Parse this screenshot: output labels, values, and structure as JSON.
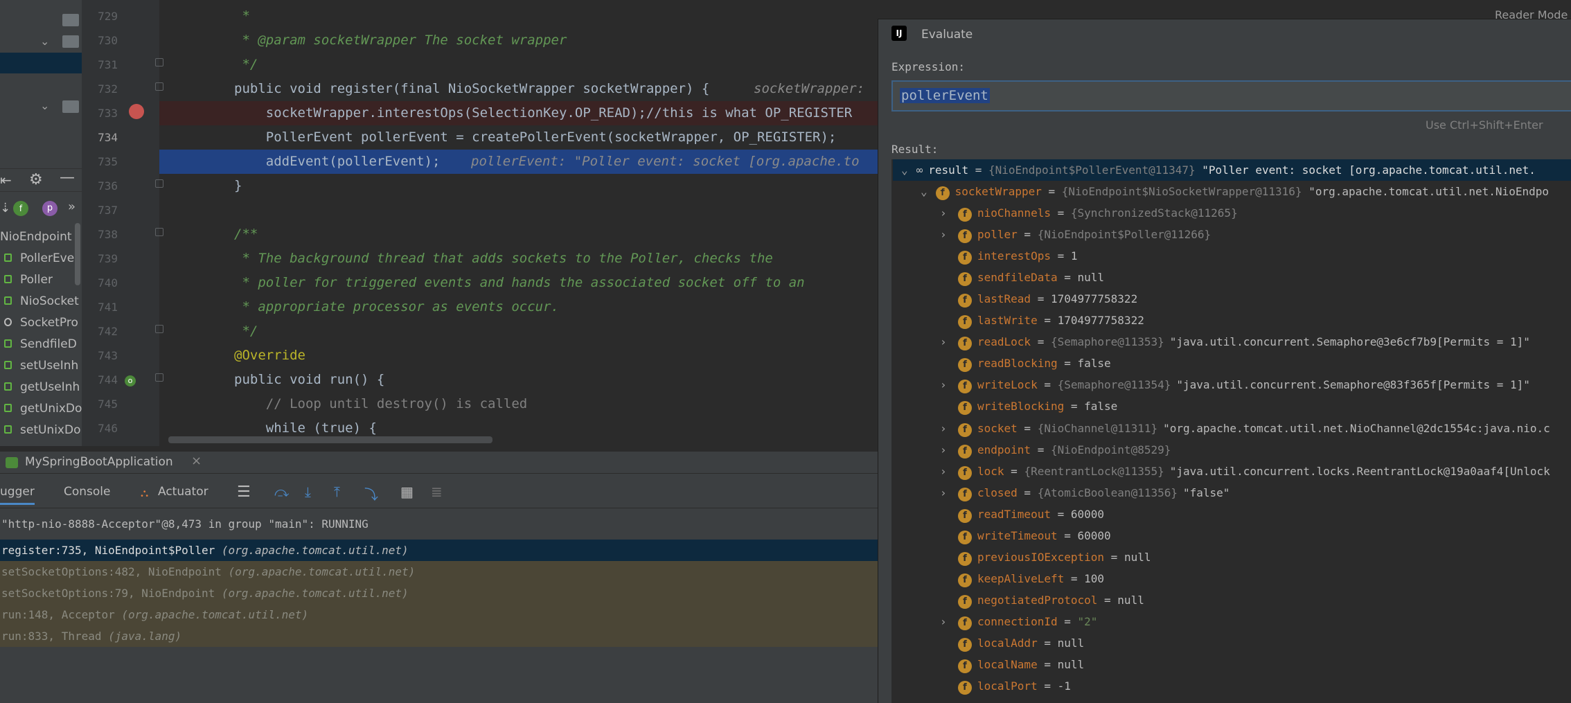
{
  "reader_mode": "Reader Mode",
  "structure": {
    "items": [
      {
        "label": "NioEndpoint",
        "icon": "class-icon"
      },
      {
        "label": "PollerEve",
        "icon": "class-icon"
      },
      {
        "label": "Poller",
        "icon": "class-icon"
      },
      {
        "label": "NioSocket",
        "icon": "class-icon"
      },
      {
        "label": "SocketPro",
        "icon": "class-icon"
      },
      {
        "label": "SendfileD",
        "icon": "class-icon"
      },
      {
        "label": "setUseInh",
        "icon": "method-icon"
      },
      {
        "label": "getUseInh",
        "icon": "method-icon"
      },
      {
        "label": "getUnixDo",
        "icon": "method-icon"
      },
      {
        "label": "setUnixDo",
        "icon": "method-icon"
      }
    ]
  },
  "editor": {
    "lines": [
      {
        "no": "729",
        "text": " *"
      },
      {
        "no": "730",
        "text": " * @param socketWrapper The socket wrapper"
      },
      {
        "no": "731",
        "text": " */"
      },
      {
        "no": "732",
        "text": "public void register(final NioSocketWrapper socketWrapper) {",
        "hint": "socketWrapper:"
      },
      {
        "no": "733",
        "text": "    socketWrapper.interestOps(SelectionKey.OP_READ);//this is what OP_REGISTER"
      },
      {
        "no": "734",
        "text": "    PollerEvent pollerEvent = createPollerEvent(socketWrapper, OP_REGISTER);"
      },
      {
        "no": "735",
        "text": "    addEvent(pollerEvent);",
        "hint": "pollerEvent: \"Poller event: socket [org.apache.to"
      },
      {
        "no": "736",
        "text": "}"
      },
      {
        "no": "737",
        "text": ""
      },
      {
        "no": "738",
        "text": "/**"
      },
      {
        "no": "739",
        "text": " * The background thread that adds sockets to the Poller, checks the"
      },
      {
        "no": "740",
        "text": " * poller for triggered events and hands the associated socket off to an"
      },
      {
        "no": "741",
        "text": " * appropriate processor as events occur."
      },
      {
        "no": "742",
        "text": " */"
      },
      {
        "no": "743",
        "text": "@Override"
      },
      {
        "no": "744",
        "text": "public void run() {"
      },
      {
        "no": "745",
        "text": "    // Loop until destroy() is called"
      },
      {
        "no": "746",
        "text": "    while (true) {"
      }
    ]
  },
  "run_config": "MySpringBootApplication",
  "debug": {
    "tabs": [
      "ugger",
      "Console",
      "Actuator"
    ],
    "thread": "\"http-nio-8888-Acceptor\"@8,473 in group \"main\": RUNNING",
    "frames": [
      {
        "method": "register:735, NioEndpoint$Poller",
        "pkg": "(org.apache.tomcat.util.net)"
      },
      {
        "method": "setSocketOptions:482, NioEndpoint",
        "pkg": "(org.apache.tomcat.util.net)"
      },
      {
        "method": "setSocketOptions:79, NioEndpoint",
        "pkg": "(org.apache.tomcat.util.net)"
      },
      {
        "method": "run:148, Acceptor",
        "pkg": "(org.apache.tomcat.util.net)"
      },
      {
        "method": "run:833, Thread",
        "pkg": "(java.lang)"
      }
    ]
  },
  "evaluate": {
    "title": "Evaluate",
    "expression_label": "Expression:",
    "expression": "pollerEvent",
    "hint": "Use Ctrl+Shift+Enter",
    "result_label": "Result:",
    "result": {
      "name": "result",
      "ref": "{NioEndpoint$PollerEvent@11347}",
      "value": "\"Poller event: socket [org.apache.tomcat.util.net."
    },
    "socket_wrapper": {
      "name": "socketWrapper",
      "ref": "{NioEndpoint$NioSocketWrapper@11316}",
      "value": "\"org.apache.tomcat.util.net.NioEndpo"
    },
    "fields": [
      {
        "name": "nioChannels",
        "eq": " = ",
        "ref": "{SynchronizedStack@11265}",
        "value": "",
        "expandable": true
      },
      {
        "name": "poller",
        "eq": " = ",
        "ref": "{NioEndpoint$Poller@11266}",
        "value": "",
        "expandable": true
      },
      {
        "name": "interestOps",
        "eq": " = ",
        "ref": "",
        "value": "1",
        "expandable": false
      },
      {
        "name": "sendfileData",
        "eq": " = ",
        "ref": "",
        "value": "null",
        "expandable": false
      },
      {
        "name": "lastRead",
        "eq": " = ",
        "ref": "",
        "value": "1704977758322",
        "expandable": false
      },
      {
        "name": "lastWrite",
        "eq": " = ",
        "ref": "",
        "value": "1704977758322",
        "expandable": false
      },
      {
        "name": "readLock",
        "eq": " = ",
        "ref": "{Semaphore@11353}",
        "value": "\"java.util.concurrent.Semaphore@3e6cf7b9[Permits = 1]\"",
        "expandable": true
      },
      {
        "name": "readBlocking",
        "eq": " = ",
        "ref": "",
        "value": "false",
        "expandable": false
      },
      {
        "name": "writeLock",
        "eq": " = ",
        "ref": "{Semaphore@11354}",
        "value": "\"java.util.concurrent.Semaphore@83f365f[Permits = 1]\"",
        "expandable": true
      },
      {
        "name": "writeBlocking",
        "eq": " = ",
        "ref": "",
        "value": "false",
        "expandable": false
      },
      {
        "name": "socket",
        "eq": " = ",
        "ref": "{NioChannel@11311}",
        "value": "\"org.apache.tomcat.util.net.NioChannel@2dc1554c:java.nio.c",
        "expandable": true
      },
      {
        "name": "endpoint",
        "eq": " = ",
        "ref": "{NioEndpoint@8529}",
        "value": "",
        "expandable": true
      },
      {
        "name": "lock",
        "eq": " = ",
        "ref": "{ReentrantLock@11355}",
        "value": "\"java.util.concurrent.locks.ReentrantLock@19a0aaf4[Unlock",
        "expandable": true
      },
      {
        "name": "closed",
        "eq": " = ",
        "ref": "{AtomicBoolean@11356}",
        "value": "\"false\"",
        "expandable": true
      },
      {
        "name": "readTimeout",
        "eq": " = ",
        "ref": "",
        "value": "60000",
        "expandable": false
      },
      {
        "name": "writeTimeout",
        "eq": " = ",
        "ref": "",
        "value": "60000",
        "expandable": false
      },
      {
        "name": "previousIOException",
        "eq": " = ",
        "ref": "",
        "value": "null",
        "expandable": false
      },
      {
        "name": "keepAliveLeft",
        "eq": " = ",
        "ref": "",
        "value": "100",
        "expandable": false
      },
      {
        "name": "negotiatedProtocol",
        "eq": " = ",
        "ref": "",
        "value": "null",
        "expandable": false
      },
      {
        "name": "connectionId",
        "eq": " = ",
        "ref": "",
        "value": "\"2\"",
        "expandable": true
      },
      {
        "name": "localAddr",
        "eq": " = ",
        "ref": "",
        "value": "null",
        "expandable": false
      },
      {
        "name": "localName",
        "eq": " = ",
        "ref": "",
        "value": "null",
        "expandable": false
      },
      {
        "name": "localPort",
        "eq": " = ",
        "ref": "",
        "value": "-1",
        "expandable": false
      }
    ]
  },
  "colors": {
    "selection": "#214283",
    "frame_bg": "#4b4636",
    "breakpoint": "#c75450",
    "field_badge": "#c08a2a"
  }
}
